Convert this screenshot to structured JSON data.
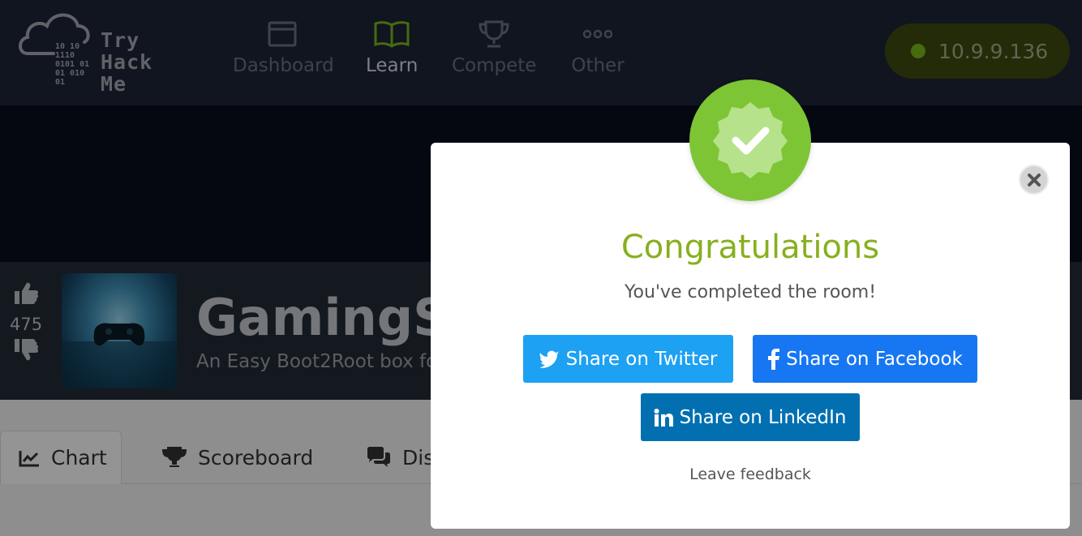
{
  "navbar": {
    "logo": {
      "line1": "Try",
      "line2": "Hack",
      "line3": "Me",
      "binary": [
        "10 10",
        "1110",
        "0101 01",
        "01  010",
        "01"
      ]
    },
    "items": [
      {
        "label": "Dashboard",
        "icon": "window-icon"
      },
      {
        "label": "Learn",
        "icon": "book-icon"
      },
      {
        "label": "Compete",
        "icon": "trophy-icon"
      },
      {
        "label": "Other",
        "icon": "dots-icon"
      }
    ],
    "ip": "10.9.9.136"
  },
  "room": {
    "likes": "475",
    "title": "GamingSe",
    "subtitle": "An Easy Boot2Root box fo"
  },
  "tabs": [
    {
      "label": "Chart",
      "icon": "chart-icon"
    },
    {
      "label": "Scoreboard",
      "icon": "trophy-icon"
    },
    {
      "label": "Dis",
      "icon": "comments-icon"
    }
  ],
  "modal": {
    "title": "Congratulations",
    "subtitle": "You've completed the room!",
    "twitter": "Share on Twitter",
    "facebook": "Share on Facebook",
    "linkedin": "Share on LinkedIn",
    "feedback": "Leave feedback"
  },
  "colors": {
    "navbar": "#1c2538",
    "accent_green": "#87b01e",
    "badge": "#7ec535",
    "twitter": "#1da1f2",
    "facebook": "#1777f2",
    "linkedin": "#0270b0"
  }
}
